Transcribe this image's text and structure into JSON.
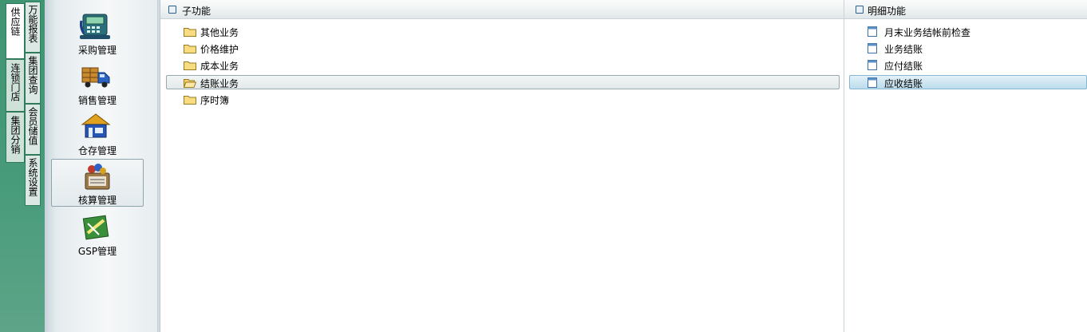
{
  "outer_tabs": [
    {
      "label": "供应链",
      "active": true
    },
    {
      "label": "连锁门店",
      "active": false
    },
    {
      "label": "集团分销",
      "active": false
    }
  ],
  "inner_tabs": [
    {
      "label": "万能报表"
    },
    {
      "label": "集团查询"
    },
    {
      "label": "会员储值"
    },
    {
      "label": "系统设置"
    }
  ],
  "modules": [
    {
      "label": "采购管理",
      "icon": "register-icon"
    },
    {
      "label": "销售管理",
      "icon": "truck-icon"
    },
    {
      "label": "仓存管理",
      "icon": "warehouse-icon"
    },
    {
      "label": "核算管理",
      "icon": "calculator-icon",
      "active": true
    },
    {
      "label": "GSP管理",
      "icon": "gsp-icon"
    }
  ],
  "subfunctions": {
    "title": "子功能",
    "items": [
      {
        "label": "其他业务"
      },
      {
        "label": "价格维护"
      },
      {
        "label": "成本业务"
      },
      {
        "label": "结账业务",
        "selected": true
      },
      {
        "label": "序时簿"
      }
    ]
  },
  "details": {
    "title": "明细功能",
    "items": [
      {
        "label": "月末业务结帐前检查"
      },
      {
        "label": "业务结账"
      },
      {
        "label": "应付结账"
      },
      {
        "label": "应收结账",
        "selected": true
      }
    ]
  },
  "colors": {
    "strip": "#479b7b",
    "selection": "#bcdcec",
    "panel_border": "#c9d3d8"
  }
}
